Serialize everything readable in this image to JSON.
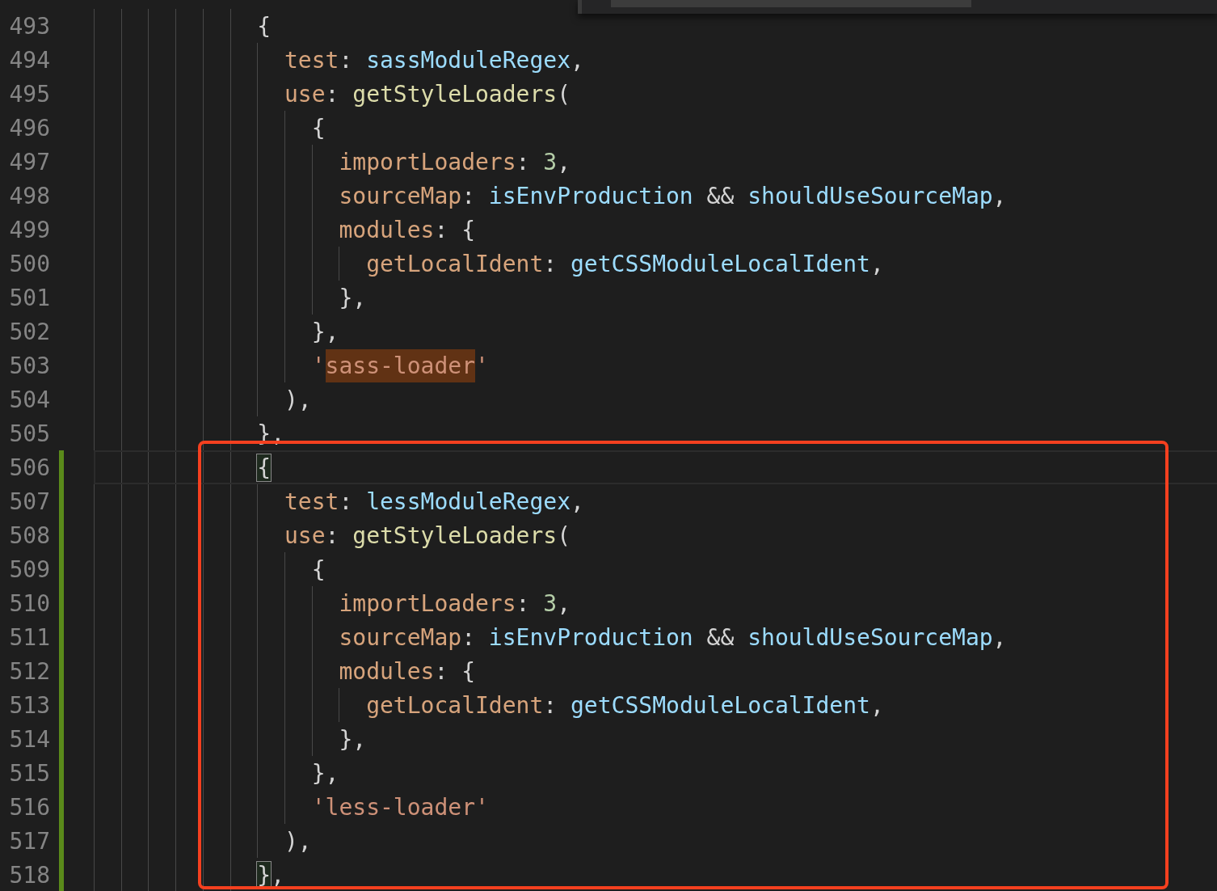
{
  "overlay_widget": true,
  "annotation_frame": true,
  "lines": [
    {
      "number": "493",
      "modified": false,
      "current": false,
      "tokens": [
        {
          "kind": "punct",
          "text": "{"
        }
      ],
      "children": [
        {
          "number": "494",
          "modified": false,
          "current": false,
          "tokens": [
            {
              "kind": "key",
              "text": "test"
            },
            {
              "kind": "punct",
              "text": ": "
            },
            {
              "kind": "var",
              "text": "sassModuleRegex"
            },
            {
              "kind": "punct",
              "text": ","
            }
          ]
        },
        {
          "number": "495",
          "modified": false,
          "current": false,
          "tokens": [
            {
              "kind": "key",
              "text": "use"
            },
            {
              "kind": "punct",
              "text": ": "
            },
            {
              "kind": "fn",
              "text": "getStyleLoaders"
            },
            {
              "kind": "punct",
              "text": "("
            }
          ],
          "children": [
            {
              "number": "496",
              "modified": false,
              "current": false,
              "tokens": [
                {
                  "kind": "punct",
                  "text": "{"
                }
              ],
              "children": [
                {
                  "number": "497",
                  "modified": false,
                  "current": false,
                  "tokens": [
                    {
                      "kind": "key",
                      "text": "importLoaders"
                    },
                    {
                      "kind": "punct",
                      "text": ": "
                    },
                    {
                      "kind": "num",
                      "text": "3"
                    },
                    {
                      "kind": "punct",
                      "text": ","
                    }
                  ]
                },
                {
                  "number": "498",
                  "modified": false,
                  "current": false,
                  "tokens": [
                    {
                      "kind": "key",
                      "text": "sourceMap"
                    },
                    {
                      "kind": "punct",
                      "text": ": "
                    },
                    {
                      "kind": "var",
                      "text": "isEnvProduction"
                    },
                    {
                      "kind": "punct",
                      "text": " && "
                    },
                    {
                      "kind": "var",
                      "text": "shouldUseSourceMap"
                    },
                    {
                      "kind": "punct",
                      "text": ","
                    }
                  ]
                },
                {
                  "number": "499",
                  "modified": false,
                  "current": false,
                  "tokens": [
                    {
                      "kind": "key",
                      "text": "modules"
                    },
                    {
                      "kind": "punct",
                      "text": ": {"
                    }
                  ],
                  "children": [
                    {
                      "number": "500",
                      "modified": false,
                      "current": false,
                      "tokens": [
                        {
                          "kind": "key",
                          "text": "getLocalIdent"
                        },
                        {
                          "kind": "punct",
                          "text": ": "
                        },
                        {
                          "kind": "var",
                          "text": "getCSSModuleLocalIdent"
                        },
                        {
                          "kind": "punct",
                          "text": ","
                        }
                      ]
                    }
                  ]
                },
                {
                  "number": "501",
                  "modified": false,
                  "current": false,
                  "tokens": [
                    {
                      "kind": "punct",
                      "text": "},"
                    }
                  ]
                }
              ]
            },
            {
              "number": "502",
              "modified": false,
              "current": false,
              "tokens": [
                {
                  "kind": "punct",
                  "text": "},"
                }
              ]
            },
            {
              "number": "503",
              "modified": false,
              "current": false,
              "tokens": [
                {
                  "kind": "str",
                  "text": "'"
                },
                {
                  "kind": "str-match",
                  "text": "sass-loader"
                },
                {
                  "kind": "str",
                  "text": "'"
                }
              ]
            }
          ]
        },
        {
          "number": "504",
          "modified": false,
          "current": false,
          "tokens": [
            {
              "kind": "punct",
              "text": "),"
            }
          ]
        }
      ]
    },
    {
      "number": "505",
      "modified": false,
      "current": false,
      "tokens": [
        {
          "kind": "punct",
          "text": "},"
        }
      ]
    },
    {
      "number": "506",
      "modified": true,
      "current": true,
      "tokens": [
        {
          "kind": "bracket-match",
          "text": "{"
        }
      ],
      "children": [
        {
          "number": "507",
          "modified": true,
          "current": false,
          "tokens": [
            {
              "kind": "key",
              "text": "test"
            },
            {
              "kind": "punct",
              "text": ": "
            },
            {
              "kind": "var",
              "text": "lessModuleRegex"
            },
            {
              "kind": "punct",
              "text": ","
            }
          ]
        },
        {
          "number": "508",
          "modified": true,
          "current": false,
          "tokens": [
            {
              "kind": "key",
              "text": "use"
            },
            {
              "kind": "punct",
              "text": ": "
            },
            {
              "kind": "fn",
              "text": "getStyleLoaders"
            },
            {
              "kind": "punct",
              "text": "("
            }
          ],
          "children": [
            {
              "number": "509",
              "modified": true,
              "current": false,
              "tokens": [
                {
                  "kind": "punct",
                  "text": "{"
                }
              ],
              "children": [
                {
                  "number": "510",
                  "modified": true,
                  "current": false,
                  "tokens": [
                    {
                      "kind": "key",
                      "text": "importLoaders"
                    },
                    {
                      "kind": "punct",
                      "text": ": "
                    },
                    {
                      "kind": "num",
                      "text": "3"
                    },
                    {
                      "kind": "punct",
                      "text": ","
                    }
                  ]
                },
                {
                  "number": "511",
                  "modified": true,
                  "current": false,
                  "tokens": [
                    {
                      "kind": "key",
                      "text": "sourceMap"
                    },
                    {
                      "kind": "punct",
                      "text": ": "
                    },
                    {
                      "kind": "var",
                      "text": "isEnvProduction"
                    },
                    {
                      "kind": "punct",
                      "text": " && "
                    },
                    {
                      "kind": "var",
                      "text": "shouldUseSourceMap"
                    },
                    {
                      "kind": "punct",
                      "text": ","
                    }
                  ]
                },
                {
                  "number": "512",
                  "modified": true,
                  "current": false,
                  "tokens": [
                    {
                      "kind": "key",
                      "text": "modules"
                    },
                    {
                      "kind": "punct",
                      "text": ": {"
                    }
                  ],
                  "children": [
                    {
                      "number": "513",
                      "modified": true,
                      "current": false,
                      "tokens": [
                        {
                          "kind": "key",
                          "text": "getLocalIdent"
                        },
                        {
                          "kind": "punct",
                          "text": ": "
                        },
                        {
                          "kind": "var",
                          "text": "getCSSModuleLocalIdent"
                        },
                        {
                          "kind": "punct",
                          "text": ","
                        }
                      ]
                    }
                  ]
                },
                {
                  "number": "514",
                  "modified": true,
                  "current": false,
                  "tokens": [
                    {
                      "kind": "punct",
                      "text": "},"
                    }
                  ]
                }
              ]
            },
            {
              "number": "515",
              "modified": true,
              "current": false,
              "tokens": [
                {
                  "kind": "punct",
                  "text": "},"
                }
              ]
            },
            {
              "number": "516",
              "modified": true,
              "current": false,
              "tokens": [
                {
                  "kind": "str",
                  "text": "'less-loader'"
                }
              ]
            }
          ]
        },
        {
          "number": "517",
          "modified": true,
          "current": false,
          "tokens": [
            {
              "kind": "punct",
              "text": "),"
            }
          ]
        }
      ]
    },
    {
      "number": "518",
      "modified": true,
      "current": false,
      "tokens": [
        {
          "kind": "bracket-match",
          "text": "}"
        },
        {
          "kind": "punct",
          "text": ","
        }
      ]
    }
  ]
}
